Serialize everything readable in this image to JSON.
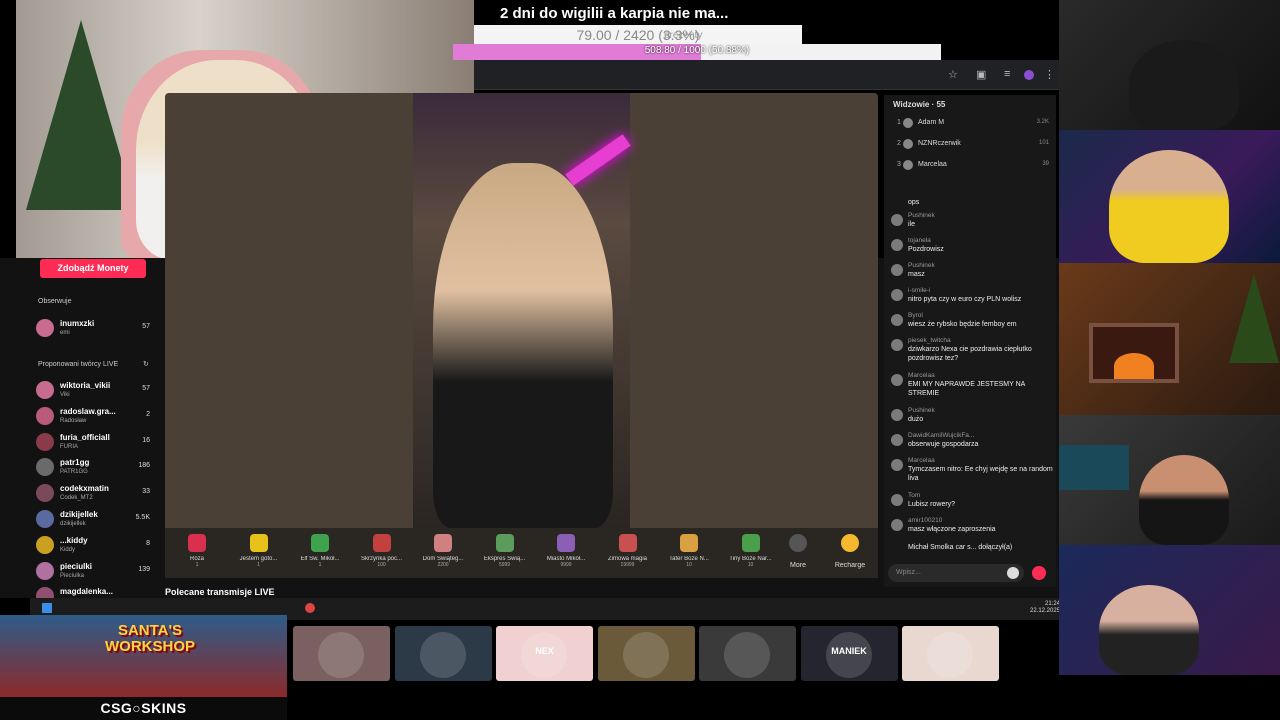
{
  "banner": {
    "title": "2 dni do wigilii a karpia nie ma...",
    "goal_text": "79.00 / 2420 (3.3%)",
    "goal_sub": "prezenty",
    "progress_text": "508.80 / 1000 (50.88%)",
    "progress_fraction": 0.5088
  },
  "sidebar": {
    "coins_button": "Zdobądź Monety",
    "followed_label": "Obserwuje",
    "followed": [
      {
        "name": "inumxzki",
        "sub": "emi",
        "count": "57"
      }
    ],
    "suggested_label": "Proponowani twórcy LIVE",
    "suggested": [
      {
        "name": "wiktoria_vikii",
        "sub": "Viki",
        "count": "57"
      },
      {
        "name": "radoslaw.gra...",
        "sub": "Radosław",
        "count": "2"
      },
      {
        "name": "furia_officiall",
        "sub": "FURIA",
        "count": "16"
      },
      {
        "name": "patr1gg",
        "sub": "PATR1GG",
        "count": "186"
      },
      {
        "name": "codekxmatin",
        "sub": "Codek_MT2",
        "count": "33"
      },
      {
        "name": "dzikijellek",
        "sub": "dzikijellek",
        "count": "5.5K"
      },
      {
        "name": "...kiddy",
        "sub": "Kiddy",
        "count": "8"
      },
      {
        "name": "pieciulki",
        "sub": "Pieciulka",
        "count": "139"
      },
      {
        "name": "magdalenka...",
        "sub": "",
        "count": ""
      }
    ],
    "recommended_label": "Polecane transmisje LIVE"
  },
  "gifts": [
    {
      "name": "Róża",
      "price": "1",
      "color": "#d9304f"
    },
    {
      "name": "Jestem goto...",
      "price": "1",
      "color": "#e6c21a"
    },
    {
      "name": "Elf Św. Mikoł...",
      "price": "1",
      "color": "#3fa34d"
    },
    {
      "name": "Skrzynka poc...",
      "price": "100",
      "color": "#c24040"
    },
    {
      "name": "Dom Świąteg...",
      "price": "2200",
      "color": "#d08080"
    },
    {
      "name": "Ekspres Świą...",
      "price": "5999",
      "color": "#5b9b5b"
    },
    {
      "name": "Miasto Mikoł...",
      "price": "9999",
      "color": "#8a5fb5"
    },
    {
      "name": "Zimowa magia",
      "price": "19999",
      "color": "#c95050"
    },
    {
      "name": "Tater Boże N...",
      "price": "10",
      "color": "#d8a040"
    },
    {
      "name": "Tiny Boże Nar...",
      "price": "10",
      "color": "#4aa04a"
    }
  ],
  "gift_more": "More",
  "gift_recharge": "Recharge",
  "viewers": {
    "title": "Widzowie · 55",
    "list": [
      {
        "rank": "1",
        "name": "Adam M",
        "count": "3.2K"
      },
      {
        "rank": "2",
        "name": "NZNRczerwik",
        "count": "101"
      },
      {
        "rank": "3",
        "name": "Marcelaa",
        "count": "39"
      }
    ]
  },
  "chat": [
    {
      "user": "",
      "text": "ops"
    },
    {
      "user": "Pushinek",
      "text": "ile"
    },
    {
      "user": "tojanela",
      "text": "Pozdrowisz"
    },
    {
      "user": "Pushinek",
      "text": "masz"
    },
    {
      "user": "i-smile-i",
      "text": "nitro pyta czy w euro czy PLN wolisz"
    },
    {
      "user": "Byrol",
      "text": "wiesz że rybsko będzie femboy em"
    },
    {
      "user": "piesek_twitcha",
      "text": "dziwkarzo Nexa cie pozdrawia ciepłutko pozdrowisz tez?"
    },
    {
      "user": "Marcelaa",
      "text": "EMI MY NAPRAWDE JESTESMY NA STREMIE"
    },
    {
      "user": "Pushinek",
      "text": "dużo"
    },
    {
      "user": "DawidKamilWujcikFa...",
      "text": "obserwuje gospodarza"
    },
    {
      "user": "Marcelaa",
      "text": "Tymczasem nitro: Ee chyj wejdę se na random liva"
    },
    {
      "user": "Tom",
      "text": "Lubisz rowery?"
    },
    {
      "user": "amir100210",
      "text": "masz włączone zaproszenia"
    },
    {
      "user": "",
      "text": "Michał Smolka car s... dołączył(a)"
    }
  ],
  "chat_input_placeholder": "Wpisz...",
  "taskbar": {
    "time": "21:24",
    "date": "22.12.2025"
  },
  "sponsor": {
    "workshop": "SANTA'S WORKSHOP",
    "brand": "CSG○SKINS"
  },
  "colors": {
    "accent": "#fe2c55",
    "progress": "#e07bd6"
  },
  "bottom_cams": [
    {
      "label": "",
      "color": "#7a6060"
    },
    {
      "label": "",
      "color": "#2c3a48"
    },
    {
      "label": "NEX",
      "color": "#f0d0d0"
    },
    {
      "label": "",
      "color": "#6a5a3a"
    },
    {
      "label": "",
      "color": "#3a3a3a"
    },
    {
      "label": "MANIEK",
      "color": "#252530"
    },
    {
      "label": "",
      "color": "#e8d8d0"
    }
  ]
}
